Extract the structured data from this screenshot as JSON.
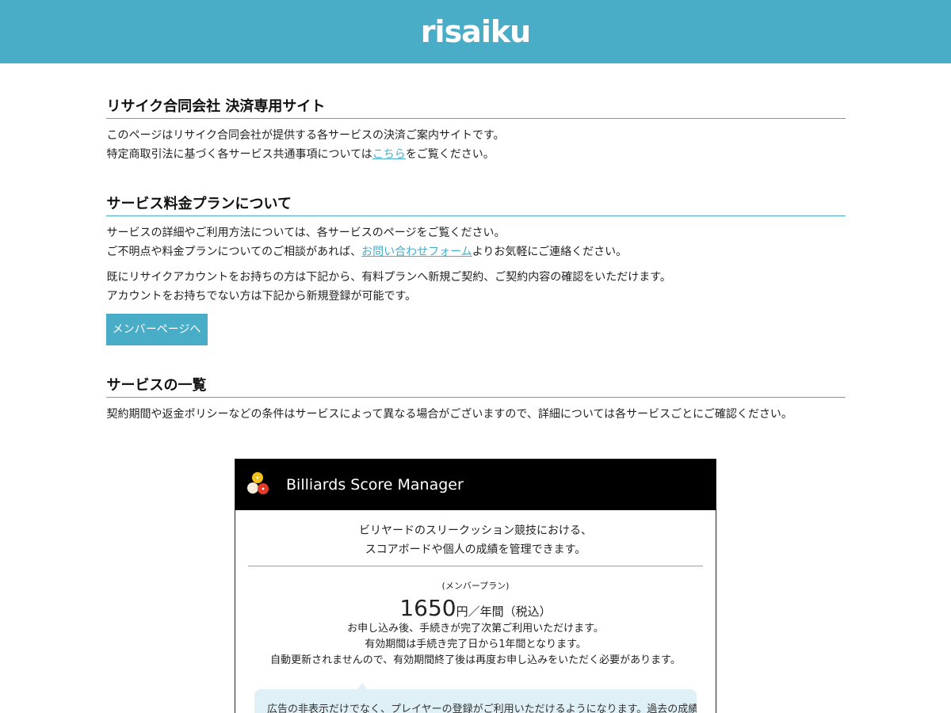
{
  "header": {
    "logo": "risaiku"
  },
  "intro": {
    "title": "リサイク合同会社 決済専用サイト",
    "line1": "このページはリサイク合同会社が提供する各サービスの決済ご案内サイトです。",
    "line2_before": "特定商取引法に基づく各サービス共通事項については",
    "line2_link": "こちら",
    "line2_after": "をご覧ください。"
  },
  "plans": {
    "title": "サービス料金プランについて",
    "line1": "サービスの詳細やご利用方法については、各サービスのページをご覧ください。",
    "line2_before": "ご不明点や料金プランについてのご相談があれば、",
    "line2_link": "お問い合わせフォーム",
    "line2_after": "よりお気軽にご連絡ください。",
    "line3": "既にリサイクアカウントをお持ちの方は下記から、有料プランへ新規ご契約、ご契約内容の確認をいただけます。",
    "line4": "アカウントをお持ちでない方は下記から新規登録が可能です。",
    "button": "メンバーページへ"
  },
  "services": {
    "title": "サービスの一覧",
    "line1": "契約期間や返金ポリシーなどの条件はサービスによって異なる場合がございますので、詳細については各サービスごとにご確認ください。"
  },
  "card": {
    "title": "Billiards Score Manager",
    "desc1": "ビリヤードのスリークッション競技における、",
    "desc2": "スコアボードや個人の成績を管理できます。",
    "plan_label": "(メンバープラン)",
    "price": "1650",
    "price_unit": "円／年間（税込）",
    "note1": "お申し込み後、手続きが完了次第ご利用いただけます。",
    "note2": "有効期間は手続き完了日から1年間となります。",
    "note3": "自動更新されませんので、有効期間終了後は再度お申し込みをいただく必要があります。",
    "bubble": "広告の非表示だけでなく、プレイヤーの登録がご利用いただけるようになります。過去の成績を確"
  },
  "colors": {
    "accent": "#4aadc8",
    "card_header": "#000000",
    "bubble": "#dff1f7"
  }
}
